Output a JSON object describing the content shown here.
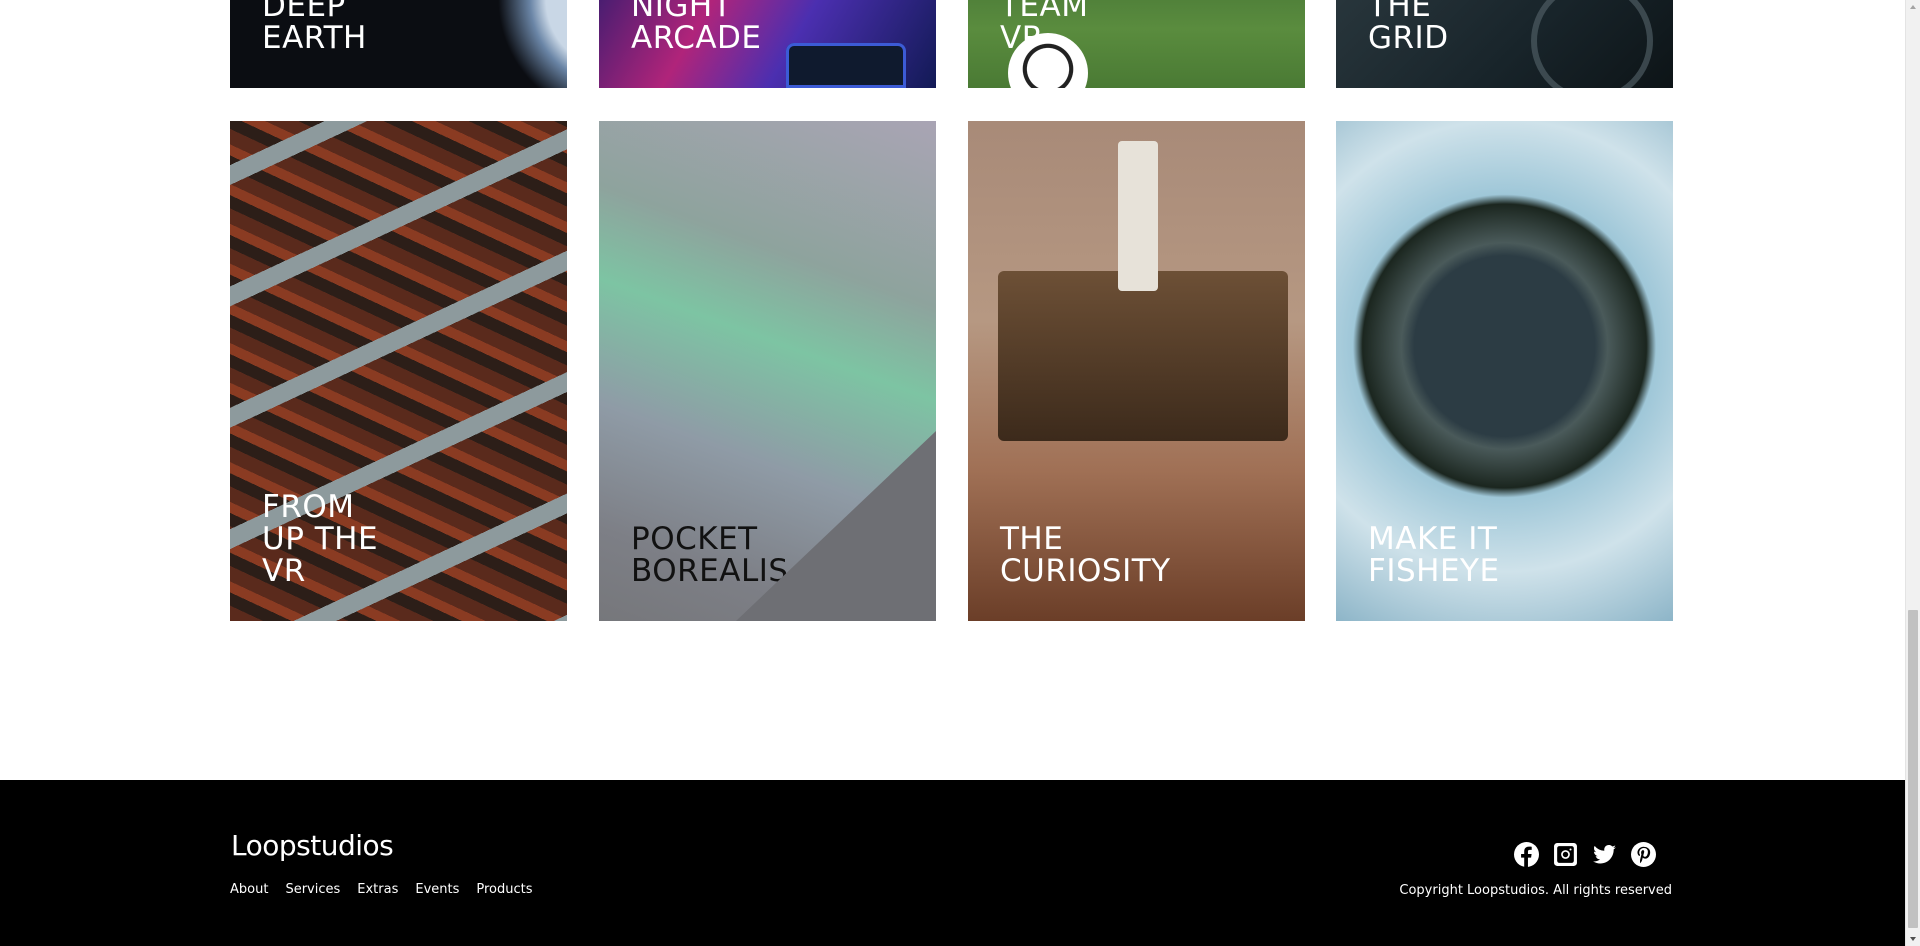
{
  "gallery": {
    "row1": [
      {
        "title": "Deep\nEarth"
      },
      {
        "title": "Night\nArcade"
      },
      {
        "title": "Team\nVR"
      },
      {
        "title": "The\nGrid"
      }
    ],
    "row2": [
      {
        "title": "From\nUp the\nVR"
      },
      {
        "title": "Pocket\nBorealis"
      },
      {
        "title": "The\nCuriosity"
      },
      {
        "title": "Make it\nFisheye"
      }
    ]
  },
  "footer": {
    "logo": "Loopstudios",
    "nav": [
      "About",
      "Services",
      "Extras",
      "Events",
      "Products"
    ],
    "socials": [
      "facebook-icon",
      "instagram-icon",
      "twitter-icon",
      "pinterest-icon"
    ],
    "copyright": "Copyright Loopstudios. All rights reserved"
  }
}
